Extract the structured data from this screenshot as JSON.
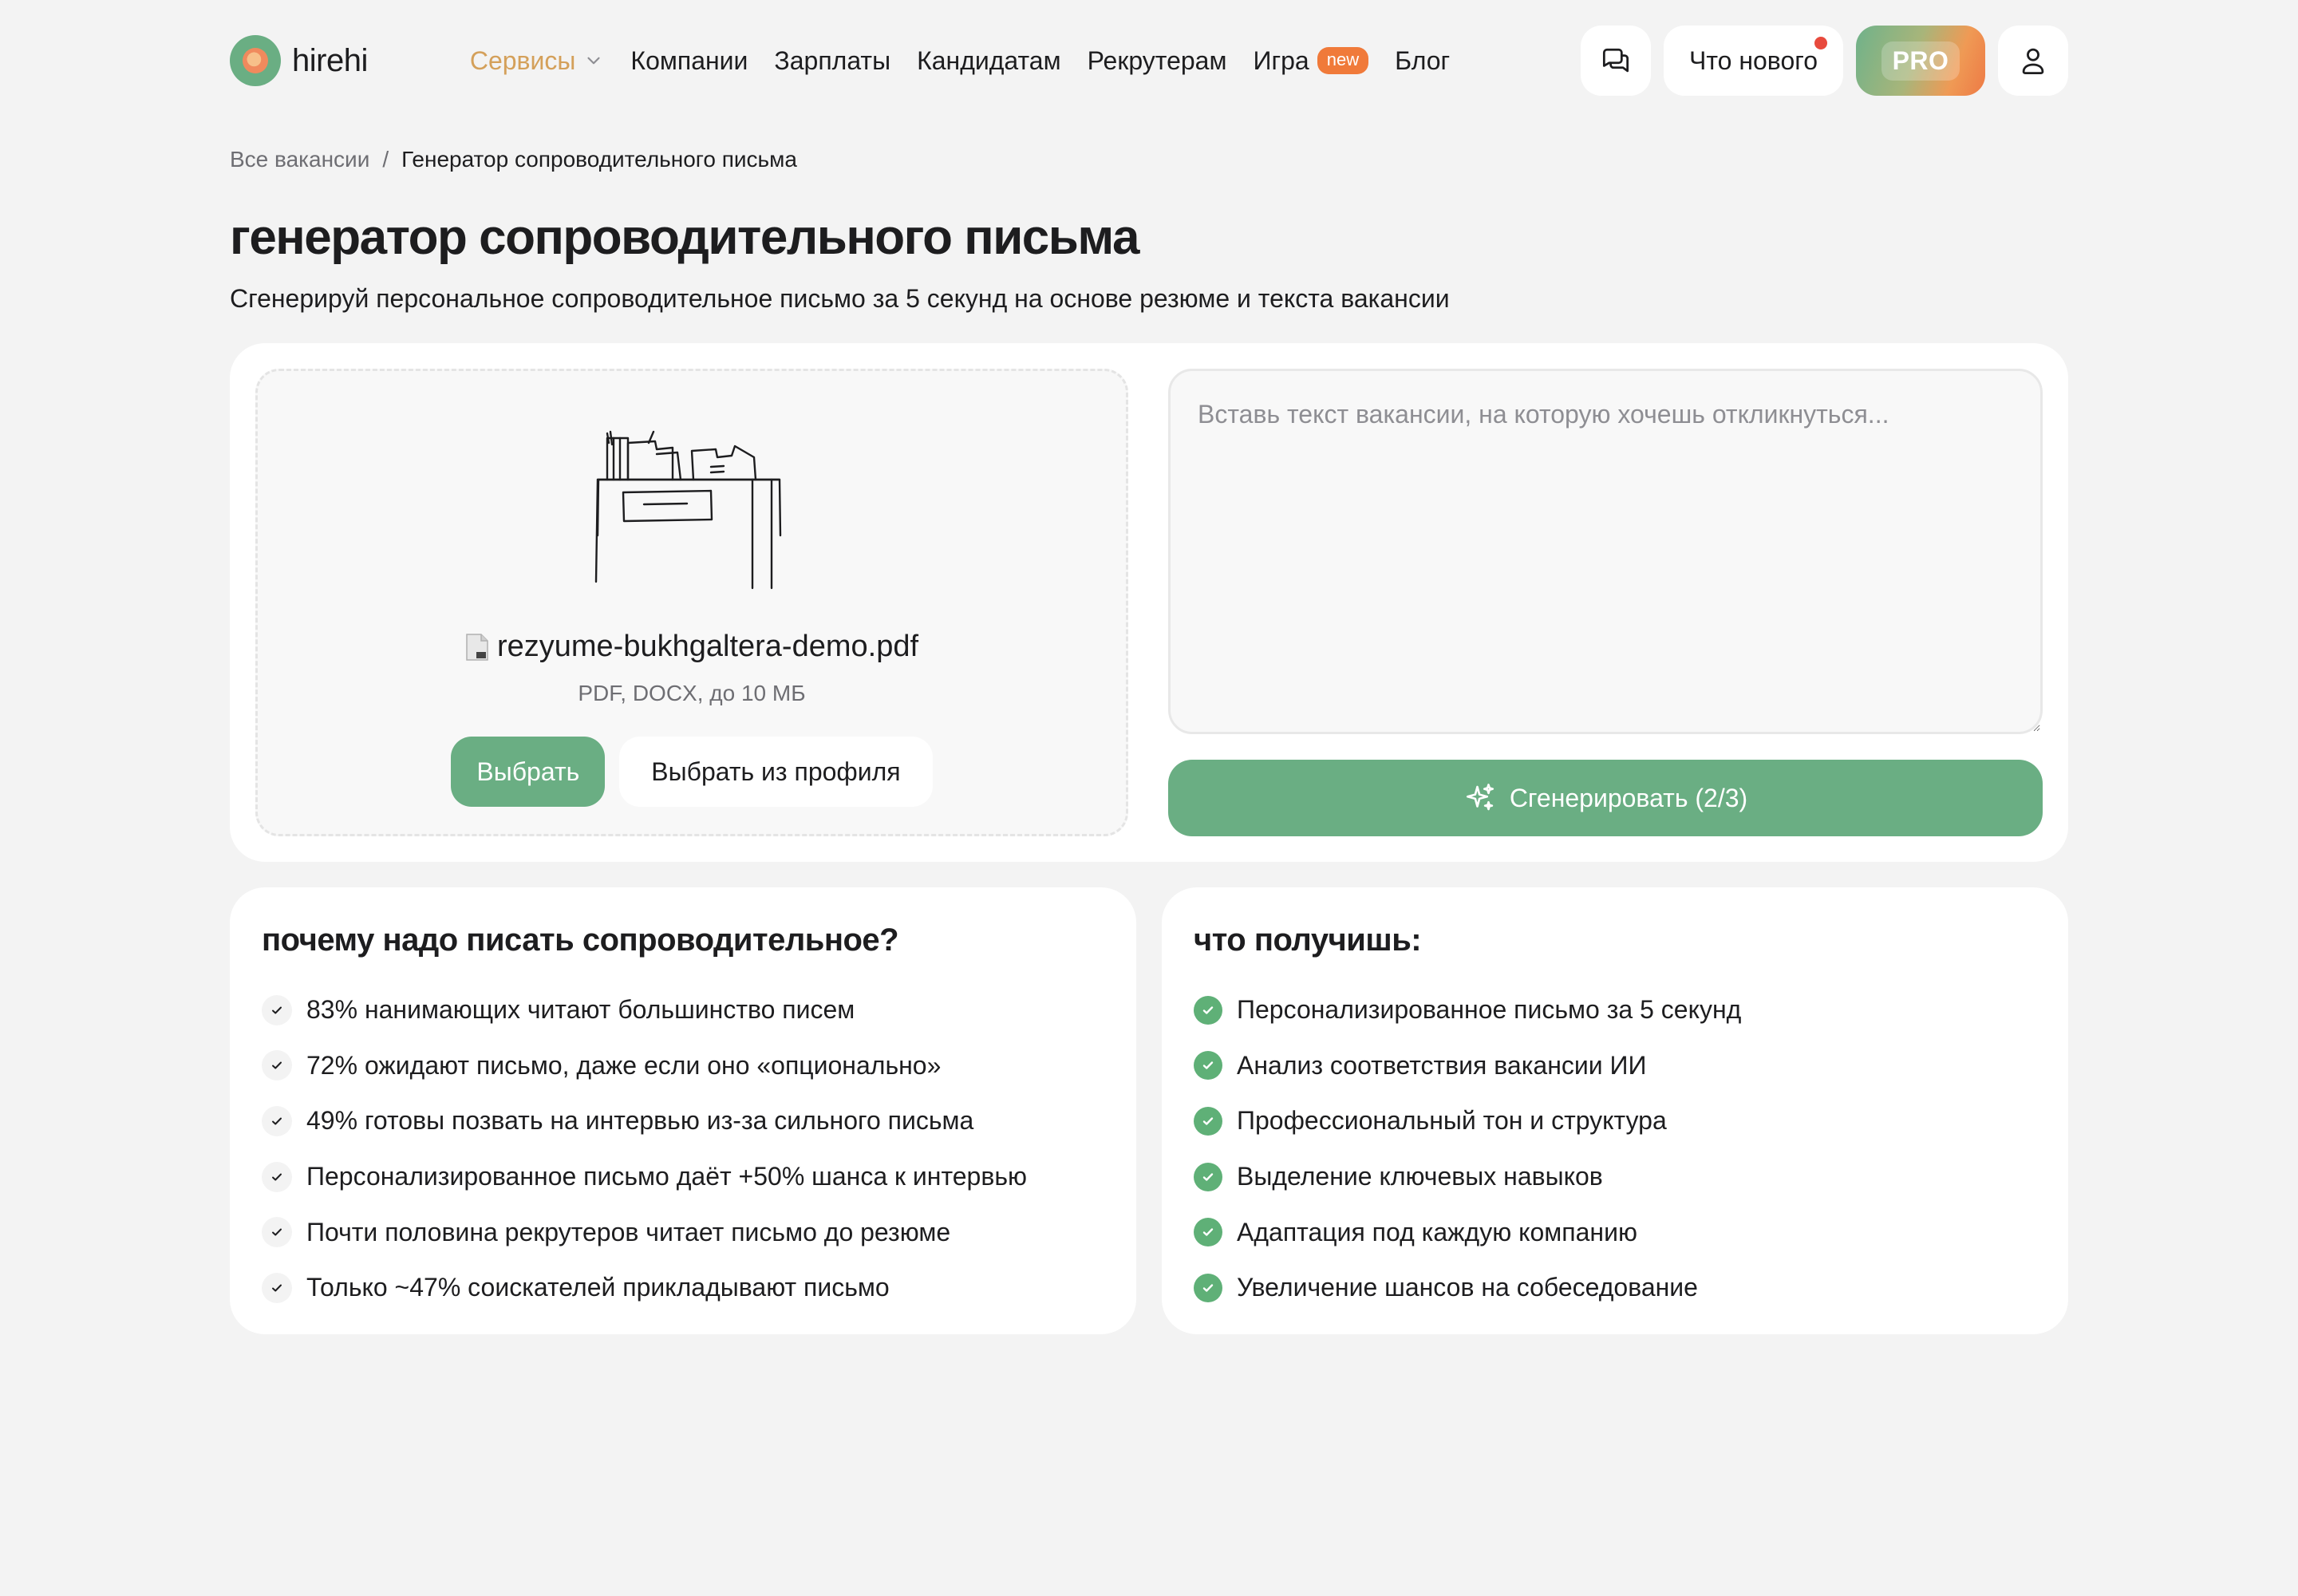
{
  "header": {
    "logo_text": "hirehi",
    "nav": {
      "services": "Сервисы",
      "companies": "Компании",
      "salaries": "Зарплаты",
      "candidates": "Кандидатам",
      "recruiters": "Рекрутерам",
      "game": "Игра",
      "game_badge": "new",
      "blog": "Блог"
    },
    "whats_new": "Что нового",
    "pro": "PRO"
  },
  "breadcrumb": {
    "all_vacancies": "Все вакансии",
    "separator": "/",
    "current": "Генератор сопроводительного письма"
  },
  "page": {
    "title": "генератор сопроводительного письма",
    "subtitle": "Сгенерируй персональное сопроводительное письмо за 5 секунд на основе резюме и текста вакансии"
  },
  "upload": {
    "file_name": "rezyume-bukhgaltera-demo.pdf",
    "hint": "PDF, DOCX, до 10 МБ",
    "choose_label": "Выбрать",
    "choose_profile_label": "Выбрать из профиля"
  },
  "vacancy": {
    "placeholder": "Вставь текст вакансии, на которую хочешь откликнуться...",
    "value": ""
  },
  "generate": {
    "label": "Сгенерировать (2/3)"
  },
  "why": {
    "title": "почему надо писать сопроводительное?",
    "items": [
      "83% нанимающих читают большинство писем",
      "72% ожидают письмо, даже если оно «опционально»",
      "49% готовы позвать на интервью из-за сильного письма",
      "Персонализированное письмо даёт +50% шанса к интервью",
      "Почти половина рекрутеров читает письмо до резюме",
      "Только ~47% соискателей прикладывают письмо"
    ]
  },
  "benefits": {
    "title": "что получишь:",
    "items": [
      "Персонализированное письмо за 5 секунд",
      "Анализ соответствия вакансии ИИ",
      "Профессиональный тон и структура",
      "Выделение ключевых навыков",
      "Адаптация под каждую компанию",
      "Увеличение шансов на собеседование"
    ]
  },
  "colors": {
    "accent_green": "#6aae83",
    "badge_orange": "#f07a3a",
    "notification_red": "#e84a3d",
    "services_gold": "#d4a05a",
    "background": "#f3f3f3"
  },
  "icons": {
    "chat": "chat-bubbles-icon",
    "profile": "user-icon",
    "sparkle": "sparkle-icon",
    "file": "file-icon",
    "check": "check-icon",
    "chevron": "chevron-down-icon"
  }
}
